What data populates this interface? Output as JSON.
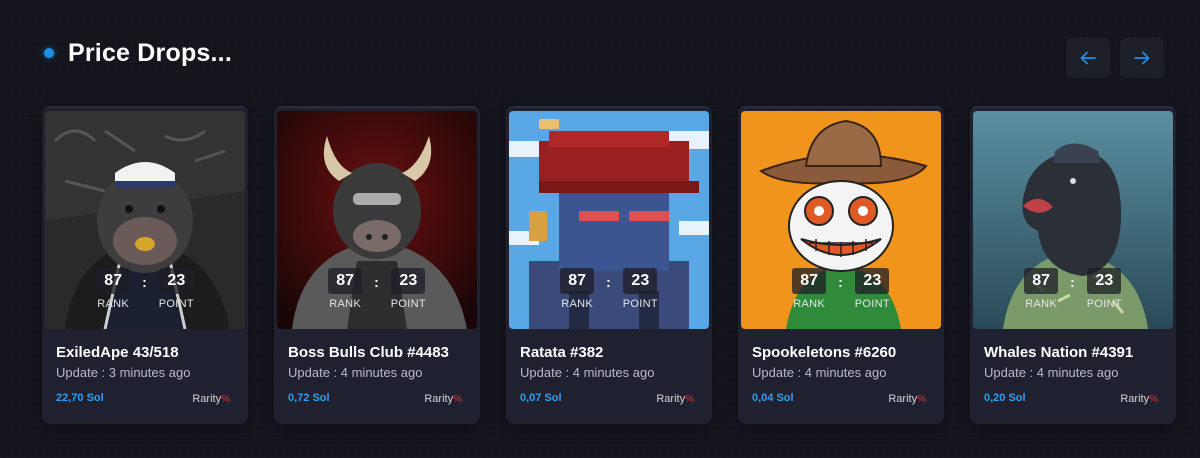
{
  "section": {
    "title": "Price Drops..."
  },
  "nav": {
    "prev_icon": "arrow-left-icon",
    "next_icon": "arrow-right-icon",
    "accent": "#1e8fe6"
  },
  "cards": [
    {
      "name": "ExiledApe 43/518",
      "update": "Update : 3 minutes ago",
      "price": "22,70 Sol",
      "rank": "87",
      "point": "23",
      "rank_label": "RANK",
      "point_label": "POINT",
      "rarity_label": "Rarity",
      "rarity_symbol": "%",
      "art": "gorilla-sailor"
    },
    {
      "name": "Boss Bulls Club #4483",
      "update": "Update : 4 minutes ago",
      "price": "0,72 Sol",
      "rank": "87",
      "point": "23",
      "rank_label": "RANK",
      "point_label": "POINT",
      "rarity_label": "Rarity",
      "rarity_symbol": "%",
      "art": "bull-sunglasses"
    },
    {
      "name": "Ratata #382",
      "update": "Update : 4 minutes ago",
      "price": "0,07 Sol",
      "rank": "87",
      "point": "23",
      "rank_label": "RANK",
      "point_label": "POINT",
      "rarity_label": "Rarity",
      "rarity_symbol": "%",
      "art": "pixel-rat"
    },
    {
      "name": "Spookeletons #6260",
      "update": "Update : 4 minutes ago",
      "price": "0,04 Sol",
      "rank": "87",
      "point": "23",
      "rank_label": "RANK",
      "point_label": "POINT",
      "rarity_label": "Rarity",
      "rarity_symbol": "%",
      "art": "skeleton-cowboy"
    },
    {
      "name": "Whales Nation #4391",
      "update": "Update : 4 minutes ago",
      "price": "0,20 Sol",
      "rank": "87",
      "point": "23",
      "rank_label": "RANK",
      "point_label": "POINT",
      "rarity_label": "Rarity",
      "rarity_symbol": "%",
      "art": "whale-hawaiian"
    }
  ]
}
